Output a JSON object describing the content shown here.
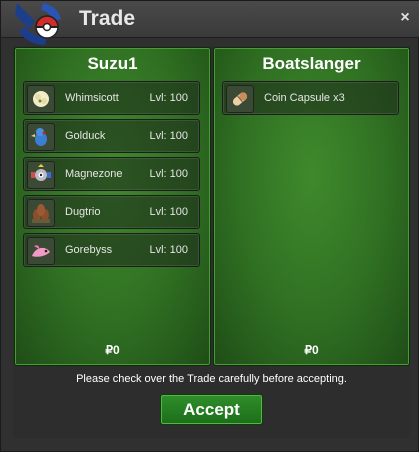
{
  "window": {
    "title": "Trade",
    "close_icon": "close-icon"
  },
  "left_panel": {
    "player": "Suzu1",
    "items": [
      {
        "name": "Whimsicott",
        "level": "Lvl: 100",
        "icon": "whimsicott-icon"
      },
      {
        "name": "Golduck",
        "level": "Lvl: 100",
        "icon": "golduck-icon"
      },
      {
        "name": "Magnezone",
        "level": "Lvl: 100",
        "icon": "magnezone-icon"
      },
      {
        "name": "Dugtrio",
        "level": "Lvl: 100",
        "icon": "dugtrio-icon"
      },
      {
        "name": "Gorebyss",
        "level": "Lvl: 100",
        "icon": "gorebyss-icon"
      }
    ],
    "money": "₽0"
  },
  "right_panel": {
    "player": "Boatslanger",
    "items": [
      {
        "name": "Coin Capsule",
        "quantity": "x3",
        "icon": "coin-capsule-icon"
      }
    ],
    "money": "₽0"
  },
  "notice": "Please check over the Trade carefully before accepting.",
  "accept_label": "Accept",
  "colors": {
    "panel_green": "#2f6f22",
    "accept_green": "#1c6e19",
    "title_bg": "#3a3a3a"
  }
}
